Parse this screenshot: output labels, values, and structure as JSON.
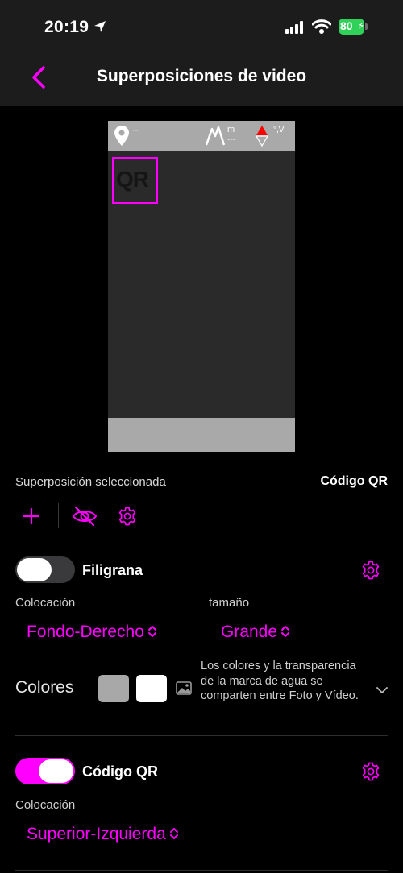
{
  "status_bar": {
    "time": "20:19",
    "battery": "80"
  },
  "nav": {
    "title": "Superposiciones de video"
  },
  "preview": {
    "qr_label": "QR",
    "altitude_unit": "m",
    "altitude_value": "---",
    "altitude_dots": "...",
    "temp_unit": "°,V"
  },
  "selected": {
    "label": "Superposición seleccionada",
    "value": "Código QR"
  },
  "watermark": {
    "toggle_label": "Filigrana",
    "enabled": false,
    "placement_label": "Colocación",
    "placement_value": "Fondo-Derecho",
    "size_label": "tamaño",
    "size_value": "Grande",
    "colors_label": "Colores",
    "swatch_colors": [
      "#a8a8a8",
      "#ffffff"
    ],
    "note": "Los colores y la transparencia de la marca de agua se comparten entre Foto y Vídeo."
  },
  "qr_code": {
    "toggle_label": "Código QR",
    "enabled": true,
    "placement_label": "Colocación",
    "placement_value": "Superior-Izquierda"
  },
  "accent_color": "#ff00ff"
}
